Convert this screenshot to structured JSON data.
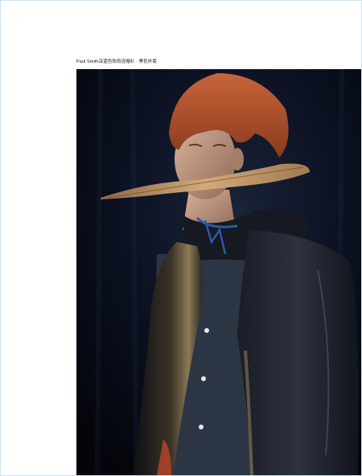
{
  "caption": {
    "text": "Paul Smith深蓝色防雨连帽衫 · 黑色外套"
  },
  "photo": {
    "subject_icon": "fashion-portrait-photo",
    "colors": {
      "background": "#070a14",
      "hair": "#b5552b",
      "skin": "#c9a08a",
      "leaf": "#b48a5c",
      "coat": "#1b1f2a",
      "shirt": "#2c3544"
    }
  }
}
